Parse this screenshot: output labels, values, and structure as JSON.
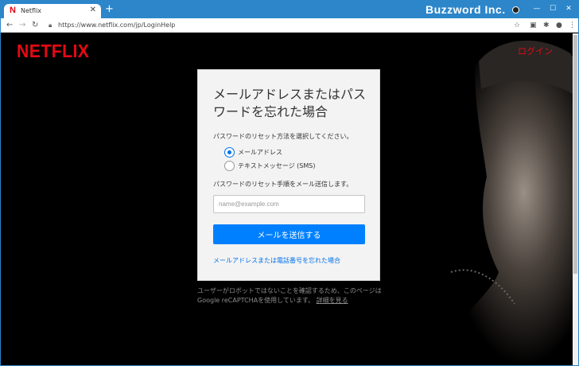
{
  "browser": {
    "tab_title": "Netflix",
    "tab_favicon": "N",
    "new_tab": "+",
    "brand": "Buzzword Inc.",
    "url": "https://www.netflix.com/jp/LoginHelp",
    "icons": [
      "back-icon",
      "forward-icon",
      "reload-icon",
      "lock-icon",
      "star-icon",
      "extension-icon",
      "puzzle-icon",
      "profile-icon",
      "menu-icon"
    ]
  },
  "header": {
    "logo": "NETFLIX",
    "login_link": "ログイン"
  },
  "card": {
    "title": "メールアドレスまたはパスワードを忘れた場合",
    "hint": "パスワードのリセット方法を選択してください。",
    "options": [
      {
        "label": "メールアドレス",
        "checked": true
      },
      {
        "label": "テキストメッセージ (SMS)",
        "checked": false
      }
    ],
    "method_note": "パスワードのリセット手順をメール送信します。",
    "email_placeholder": "name@example.com",
    "submit_label": "メールを送信する",
    "forgot_link": "メールアドレスまたは電話番号を忘れた場合"
  },
  "captcha": {
    "text": "ユーザーがロボットではないことを確認するため、このページはGoogle reCAPTCHAを使用しています。",
    "link": "詳細を見る"
  },
  "colors": {
    "netflix_red": "#e50914",
    "button_blue": "#0080ff",
    "link_blue": "#0071eb",
    "chrome_blue": "#2c86c9"
  }
}
